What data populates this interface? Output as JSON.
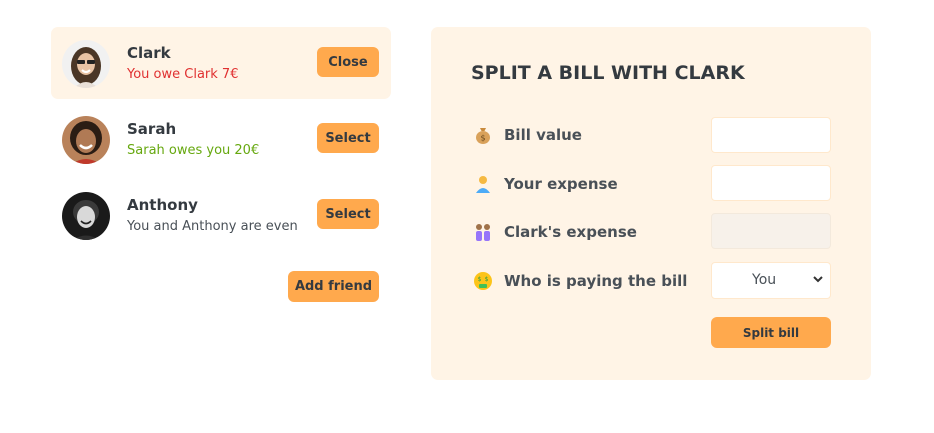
{
  "friends": [
    {
      "name": "Clark",
      "status": "You owe Clark 7€",
      "status_tone": "red",
      "button_label": "Close",
      "selected": true
    },
    {
      "name": "Sarah",
      "status": "Sarah owes you 20€",
      "status_tone": "green",
      "button_label": "Select",
      "selected": false
    },
    {
      "name": "Anthony",
      "status": "You and Anthony are even",
      "status_tone": "gray",
      "button_label": "Select",
      "selected": false
    }
  ],
  "add_friend_label": "Add friend",
  "form": {
    "title": "Split a bill with Clark",
    "bill_value_label": "Bill value",
    "bill_value_icon": "money-bag-icon",
    "your_expense_label": "Your expense",
    "your_expense_icon": "person-icon",
    "friend_expense_label": "Clark's expense",
    "friend_expense_icon": "two-people-icon",
    "payer_label": "Who is paying the bill",
    "payer_icon": "money-face-icon",
    "payer_value": "You",
    "submit_label": "Split bill"
  },
  "colors": {
    "accent": "#ffa94d",
    "panel_bg": "#fff4e6",
    "owe_red": "#e03131",
    "owed_green": "#66a80f"
  }
}
